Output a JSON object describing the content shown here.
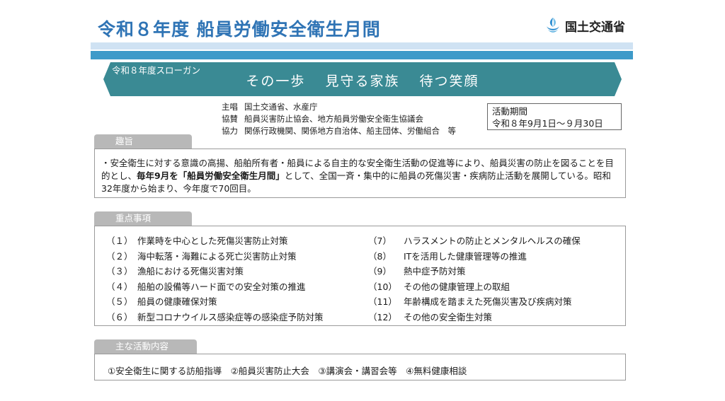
{
  "header": {
    "title": "令和８年度 船員労働安全衛生月間",
    "ministry": "国土交通省"
  },
  "slogan": {
    "label": "令和８年度スローガン",
    "parts": [
      "その一歩",
      "見守る家族",
      "待つ笑顔"
    ]
  },
  "sponsors": [
    {
      "role": "主唱",
      "orgs": "国土交通省、水産庁"
    },
    {
      "role": "協賛",
      "orgs": "船員災害防止協会、地方船員労働安全衛生協議会"
    },
    {
      "role": "協力",
      "orgs": "関係行政機関、関係地方自治体、船主団体、労働組合　等"
    }
  ],
  "period": {
    "label": "活動期間",
    "value": "令和８年9月1日～９月30日"
  },
  "purpose": {
    "heading": "趣旨",
    "text_before": "・安全衛生に対する意識の高揚、船舶所有者・船員による自主的な安全衛生活動の促進等により、船員災害の防止を図ることを目的とし、",
    "text_bold": "毎年9月を「船員労働安全衛生月間」",
    "text_after": "として、全国一斉・集中的に船員の死傷災害・疾病防止活動を展開している。昭和32年度から始まり、今年度で70回目。"
  },
  "focus": {
    "heading": "重点事項",
    "left": [
      {
        "num": "（１）",
        "text": "作業時を中心とした死傷災害防止対策"
      },
      {
        "num": "（２）",
        "text": "海中転落・海難による死亡災害防止対策"
      },
      {
        "num": "（３）",
        "text": "漁船における死傷災害対策"
      },
      {
        "num": "（４）",
        "text": "船舶の設備等ハード面での安全対策の推進"
      },
      {
        "num": "（５）",
        "text": "船員の健康確保対策"
      },
      {
        "num": "（６）",
        "text": "新型コロナウイルス感染症等の感染症予防対策"
      }
    ],
    "right": [
      {
        "num": "（7）",
        "text": "ハラスメントの防止とメンタルヘルスの確保"
      },
      {
        "num": "（8）",
        "text": "ITを活用した健康管理等の推進"
      },
      {
        "num": "（9）",
        "text": "熱中症予防対策"
      },
      {
        "num": "（10）",
        "text": "その他の健康管理上の取組"
      },
      {
        "num": "（11）",
        "text": "年齢構成を踏まえた死傷災害及び疾病対策"
      },
      {
        "num": "（12）",
        "text": "その他の安全衛生対策"
      }
    ]
  },
  "activities": {
    "heading": "主な活動内容",
    "text": "①安全衛生に関する訪船指導　②船員災害防止大会　③講演会・講習会等　④無料健康相談"
  },
  "colors": {
    "title": "#2f74b5",
    "banner": "#3a8a94",
    "stripe_dark": "#3d9ac9",
    "stripe_light": "#cfe2f3",
    "tab": "#b8b8b8"
  }
}
